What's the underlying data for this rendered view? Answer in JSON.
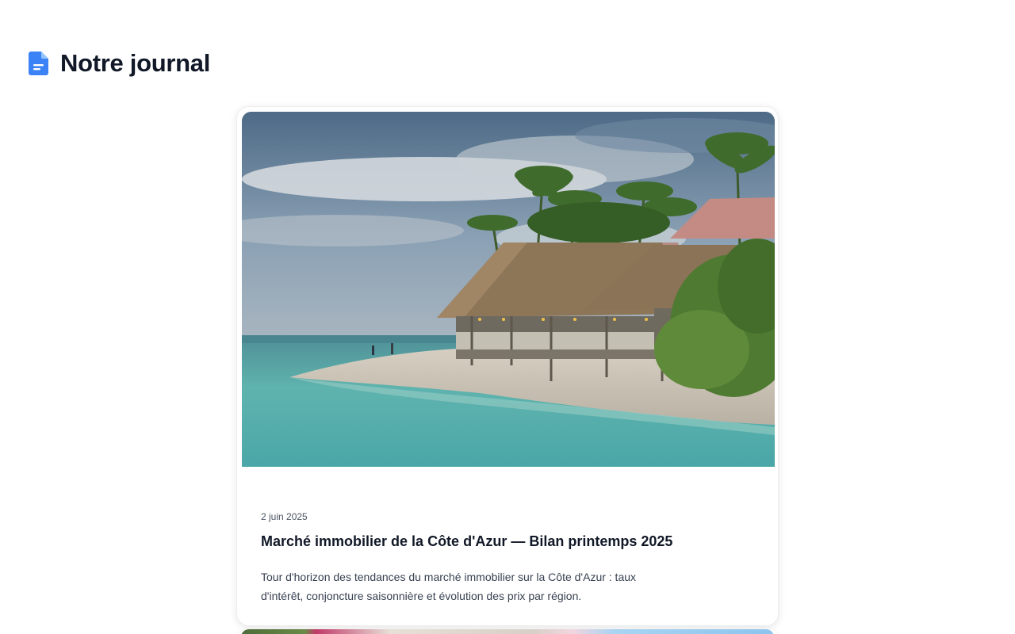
{
  "page": {
    "title": "Notre journal",
    "title_icon": "document-icon",
    "accent_color": "#3b82f6"
  },
  "posts": [
    {
      "date": "2 juin 2025",
      "title": "Marché immobilier de la Côte d'Azur — Bilan printemps 2025",
      "excerpt": "Tour d'horizon des tendances du marché immobilier sur la Côte d'Azur : taux d'intérêt, conjoncture saisonnière et évolution des prix par région.",
      "image": "beach-bungalow-photo"
    },
    {
      "image": "garden-flowers-photo"
    }
  ]
}
